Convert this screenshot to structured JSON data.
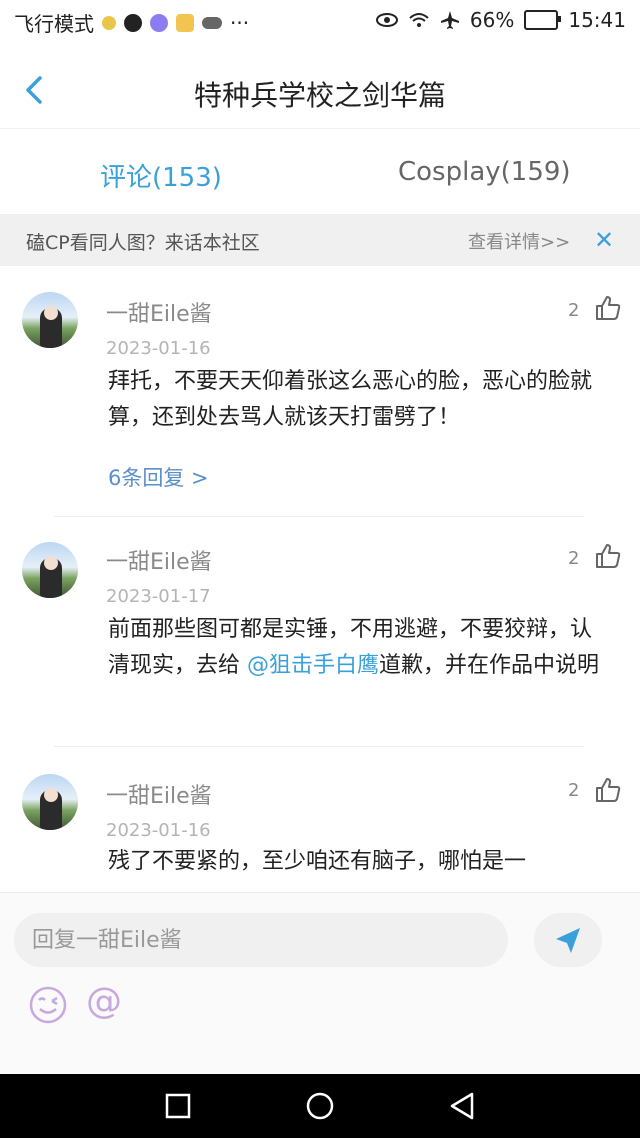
{
  "status_bar": {
    "left_text": "飞行模式",
    "more": "···",
    "battery": "66%",
    "time": "15:41"
  },
  "header": {
    "title": "特种兵学校之剑华篇"
  },
  "tabs": [
    {
      "label": "评论(153)"
    },
    {
      "label": "Cosplay(159)"
    }
  ],
  "banner": {
    "text": "磕CP看同人图？来话本社区",
    "more": "查看详情>>",
    "close": "✕"
  },
  "comments": [
    {
      "user": "一甜Eile酱",
      "date": "2023-01-16",
      "likes": "2",
      "text": "拜托，不要天天仰着张这么恶心的脸，恶心的脸就算，还到处去骂人就该天打雷劈了！",
      "replies": "6条回复 >"
    },
    {
      "user": "一甜Eile酱",
      "date": "2023-01-17",
      "likes": "2",
      "text_before": "前面那些图可都是实锤，不用逃避，不要狡辩，认清现实，去给 ",
      "mention": "@狙击手白鹰",
      "text_after": "道歉，并在作品中说明"
    },
    {
      "user": "一甜Eile酱",
      "date": "2023-01-16",
      "likes": "2",
      "text": "残了不要紧的，至少咱还有脑子，哪怕是一"
    }
  ],
  "input": {
    "placeholder": "回复一甜Eile酱"
  },
  "colors": {
    "accent": "#3aa0dc",
    "reply_link": "#5b8fc7",
    "emoji": "#c7a8e0"
  }
}
